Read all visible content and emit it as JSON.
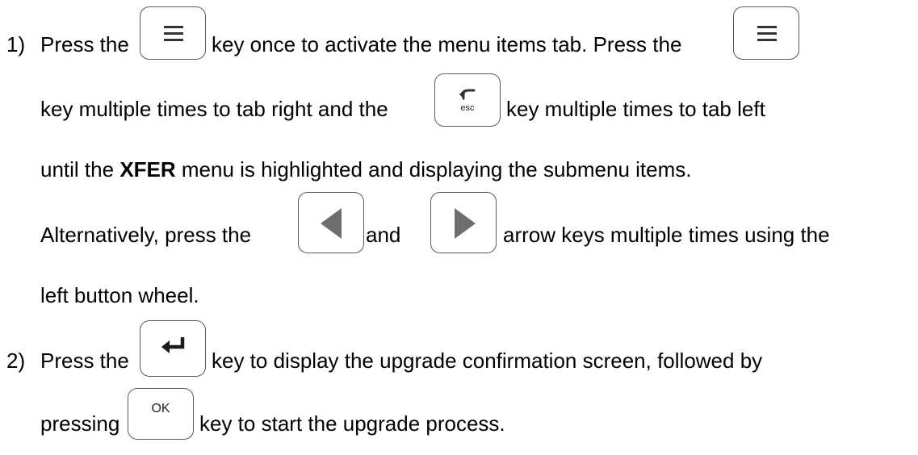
{
  "steps": [
    {
      "number": "1)",
      "line1": {
        "a": "Press the",
        "b": "key once to activate the menu items tab.  Press the"
      },
      "line2": {
        "a": "key multiple times to tab right and the",
        "b": "key multiple times to tab left"
      },
      "line3": {
        "a": "until the",
        "bold": "XFER",
        "b": "menu is highlighted and displaying the submenu items."
      },
      "line4": {
        "a": "Alternatively, press the",
        "b": "and",
        "c": "arrow keys multiple times using the"
      },
      "line5": "left button wheel."
    },
    {
      "number": "2)",
      "line1": {
        "a": "Press the",
        "b": "key to display the upgrade confirmation screen, followed by"
      },
      "line2": {
        "a": "pressing",
        "b": "key to start the upgrade process."
      }
    }
  ],
  "keys": {
    "menu": {
      "icon": "menu-icon"
    },
    "esc": {
      "icon": "back-arrow-icon",
      "label": "esc"
    },
    "left": {
      "icon": "triangle-left-icon"
    },
    "right": {
      "icon": "triangle-right-icon"
    },
    "enter": {
      "icon": "enter-arrow-icon"
    },
    "ok": {
      "label": "OK"
    }
  },
  "colors": {
    "text": "#000000",
    "key_border": "#5a5a5a",
    "icon_dark": "#333333",
    "triangle_gray": "#6e6e6e"
  }
}
